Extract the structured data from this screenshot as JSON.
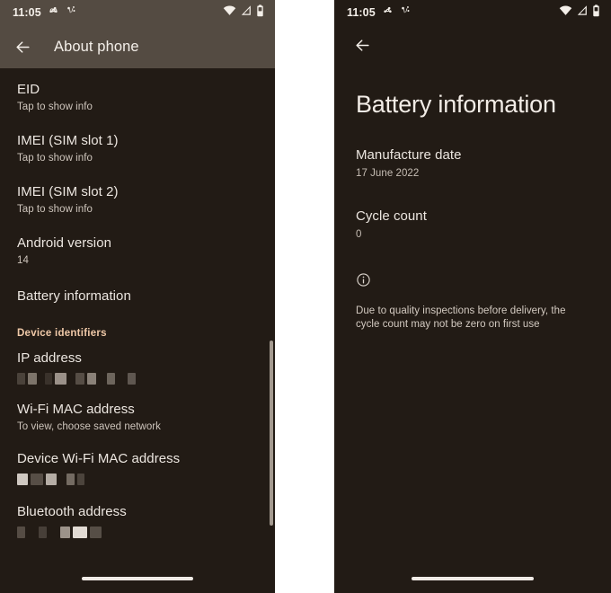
{
  "colors": {
    "panel_bg": "#221b15",
    "appbar_bg": "#544b42",
    "accent_section": "#f0c9a8",
    "primary_text": "#ece6e0",
    "secondary_text": "#c7beb5",
    "indicator": "#f0ebe6"
  },
  "left_phone": {
    "status_bar": {
      "clock": "11:05",
      "notification_icons": [
        "pinwheel-app-icon",
        "connection-dots-app-icon"
      ],
      "system_icons": [
        "wifi-icon",
        "cellular-signal-icon",
        "battery-icon"
      ]
    },
    "app_bar": {
      "back_icon": "back-arrow-icon",
      "title": "About phone"
    },
    "list": [
      {
        "title": "EID",
        "subtitle": "Tap to show info",
        "type": "item"
      },
      {
        "title": "IMEI (SIM slot 1)",
        "subtitle": "Tap to show info",
        "type": "item"
      },
      {
        "title": "IMEI (SIM slot 2)",
        "subtitle": "Tap to show info",
        "type": "item"
      },
      {
        "title": "Android version",
        "subtitle": "14",
        "type": "item"
      },
      {
        "title": "Battery information",
        "subtitle": "",
        "type": "item"
      },
      {
        "title": "Device identifiers",
        "type": "section"
      },
      {
        "title": "IP address",
        "subtitle": "",
        "type": "redacted"
      },
      {
        "title": "Wi-Fi MAC address",
        "subtitle": "To view, choose saved network",
        "type": "item"
      },
      {
        "title": "Device Wi-Fi MAC address",
        "subtitle": "",
        "type": "redacted"
      },
      {
        "title": "Bluetooth address",
        "subtitle": "",
        "type": "redacted"
      }
    ],
    "scrollbar": {
      "name": "vertical-scrollbar"
    },
    "home_indicator": "home-indicator"
  },
  "right_phone": {
    "status_bar": {
      "clock": "11:05",
      "notification_icons": [
        "pinwheel-app-icon",
        "connection-dots-app-icon"
      ],
      "system_icons": [
        "wifi-icon",
        "cellular-signal-icon",
        "battery-icon"
      ]
    },
    "top_bar": {
      "back_icon": "back-arrow-icon"
    },
    "page_title": "Battery information",
    "fields": [
      {
        "label": "Manufacture date",
        "value": "17 June 2022"
      },
      {
        "label": "Cycle count",
        "value": "0"
      }
    ],
    "note": {
      "icon": "info-circle-icon",
      "text": "Due to quality inspections before delivery, the cycle count may not be zero on first use"
    },
    "home_indicator": "home-indicator"
  }
}
